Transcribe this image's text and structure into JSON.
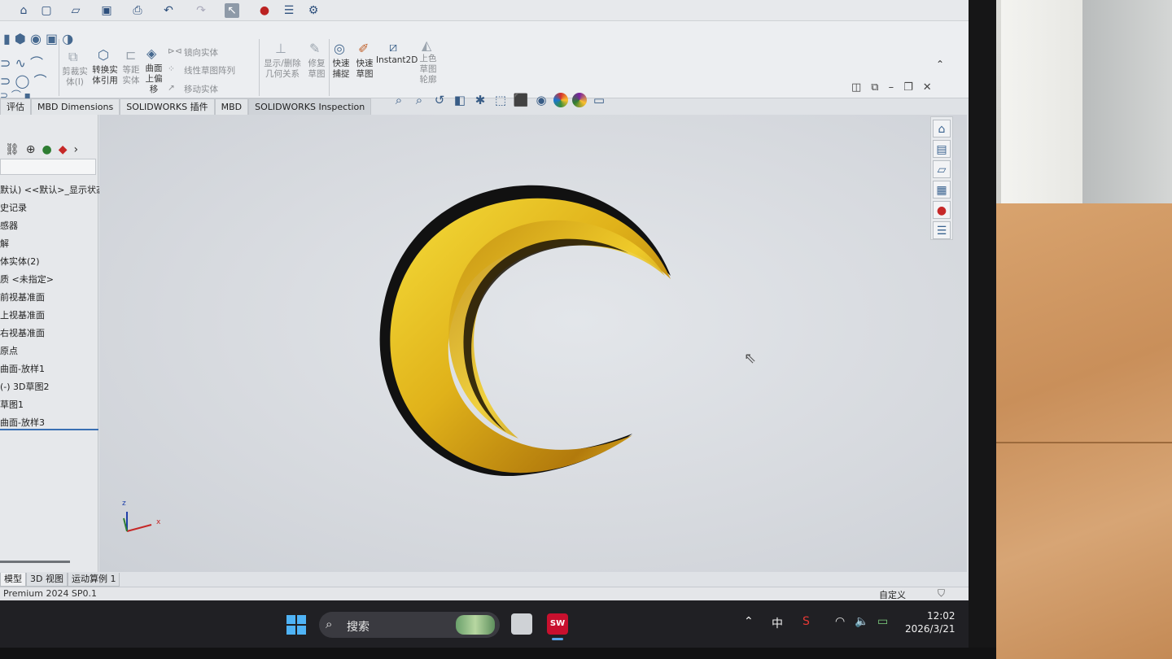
{
  "colors": {
    "accent": "#3a6fb3",
    "model_gold": "#e6b814",
    "taskbar": "#202024"
  },
  "qat_icons": [
    "home-icon",
    "new-file-icon",
    "open-file-icon",
    "save-icon",
    "print-icon",
    "undo-icon",
    "redo-icon",
    "select-icon",
    "traffic-light-icon",
    "file-properties-icon",
    "options-gear-icon"
  ],
  "command_manager": {
    "cut_body": "剪裁实体(I)",
    "convert_entities": "转换实体引用",
    "offset_entities": "等距实体",
    "offset_on_surface": "曲面上偏移",
    "mirror_entities": "镜向实体",
    "linear_pattern": "线性草图阵列",
    "move_entities": "移动实体",
    "display_relations": "显示/删除几何关系",
    "repair_sketch": "修复草图",
    "quick_snaps": "快速捕捉",
    "rapid_sketch": "快速草图",
    "instant2d": "Instant2D",
    "shaded_sketch_contours": "上色草图轮廓"
  },
  "tabs": [
    "评估",
    "MBD Dimensions",
    "SOLIDWORKS 插件",
    "MBD",
    "SOLIDWORKS Inspection"
  ],
  "feature_tree": [
    "默认) <<默认>_显示状态",
    "史记录",
    "感器",
    "解",
    "体实体(2)",
    "质 <未指定>",
    "前视基准面",
    "上视基准面",
    "右视基准面",
    "原点",
    "曲面-放样1",
    "(-) 3D草图2",
    "草图1",
    "曲面-放样3"
  ],
  "triad": {
    "z": "z",
    "x": "x"
  },
  "bottom_tabs": [
    "模型",
    "3D 视图",
    "运动算例 1"
  ],
  "status": {
    "version": "Premium 2024 SP0.1",
    "units": "自定义"
  },
  "taskbar": {
    "search_label": "搜索",
    "ime": "中",
    "time": "12:02",
    "date": "2026/3/21",
    "sw_badge": "SW"
  }
}
